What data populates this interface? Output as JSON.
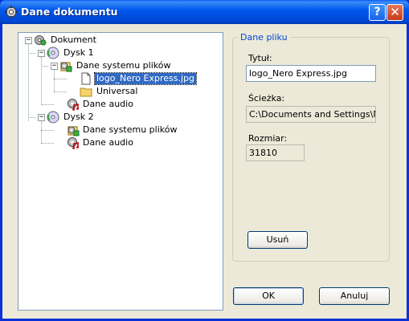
{
  "window": {
    "title": "Dane dokumentu",
    "help_label": "?",
    "close_label": "✕"
  },
  "tree": {
    "root": "Dokument",
    "disk1": "Dysk 1",
    "disk1_fs": "Dane systemu plików",
    "disk1_file": "logo_Nero Express.jpg",
    "disk1_folder": "Universal",
    "disk1_audio": "Dane audio",
    "disk2": "Dysk 2",
    "disk2_fs": "Dane systemu plików",
    "disk2_audio": "Dane audio"
  },
  "file_panel": {
    "group_title": "Dane pliku",
    "title_label": "Tytuł:",
    "title_value": "logo_Nero Express.jpg",
    "path_label": "Ścieżka:",
    "path_value": "C:\\Documents and Settings\\Mar",
    "size_label": "Rozmiar:",
    "size_value": "31810",
    "remove_button": "Usuń"
  },
  "buttons": {
    "ok": "OK",
    "cancel": "Anuluj"
  },
  "icons": {
    "app": "document-settings-icon",
    "disc": "disc-icon",
    "data": "data-file-system-icon",
    "file": "file-icon",
    "folder": "folder-icon",
    "audio": "audio-data-icon"
  }
}
